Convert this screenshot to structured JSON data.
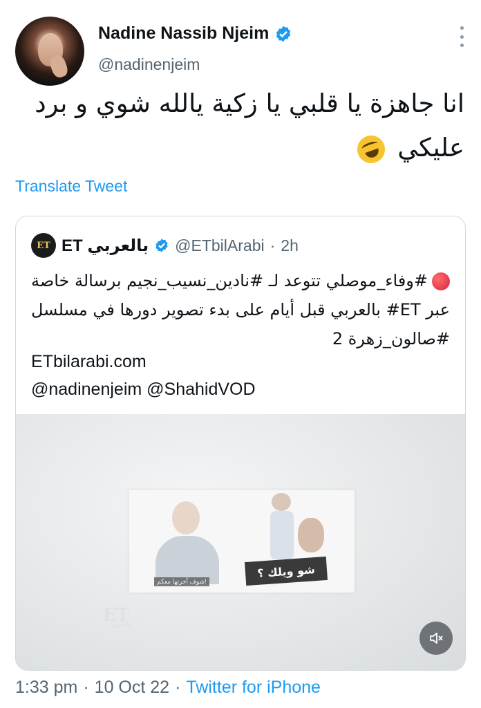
{
  "tweet": {
    "author_name": "Nadine Nassib Njeim",
    "author_handle": "@nadinenjeim",
    "text": "انا جاهزة يا قلبي يا زكية يالله شوي و برد عليكي",
    "emoji_icon": "rolling-on-floor-laughing-icon",
    "translate_label": "Translate Tweet"
  },
  "quote": {
    "name": "ET بالعربي",
    "logo_text": "ET",
    "handle": "@ETbilArabi",
    "separator": "·",
    "time": "2h",
    "text": "#وفاء_موصلي تتوعد لـ #نادين_نسيب_نجيم برسالة خاصة عبر ET# بالعربي قبل أيام على بدء تصوير دورها في مسلسل #صالون_زهرة 2",
    "link": "ETbilarabi.com",
    "mentions": "@nadinenjeim @ShahidVOD",
    "media": {
      "caption": "شوف آخرتها معكم!",
      "speech_text": "شو ويلك ؟",
      "watermark": "ET",
      "watermark_sub": "بالعربي"
    }
  },
  "footer": {
    "time": "1:33 pm",
    "sep1": "·",
    "date": "10 Oct 22",
    "sep2": "·",
    "source": "Twitter for iPhone"
  },
  "colors": {
    "accent": "#1d9bf0",
    "secondary_text": "#536471",
    "border": "#cfd9de"
  }
}
